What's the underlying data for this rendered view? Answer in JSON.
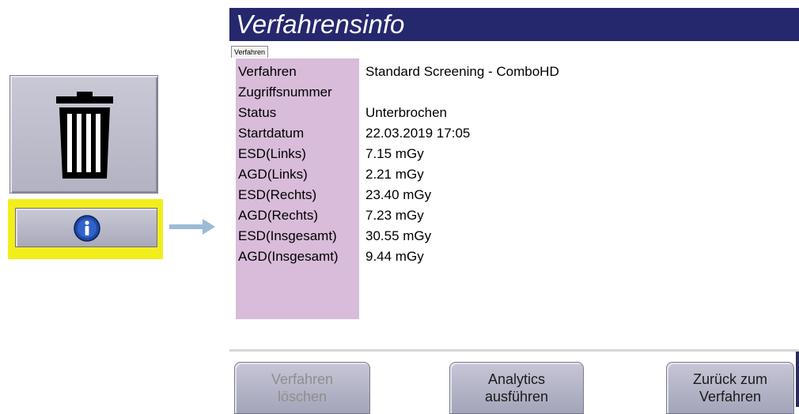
{
  "left_toolbar": {
    "trash_icon": "trash-icon",
    "info_icon": "info-icon",
    "highlight_color": "#f2ee1c",
    "arrow_color": "#9bbbd6"
  },
  "panel": {
    "title": "Verfahrensinfo",
    "title_bar_color": "#26286e",
    "tab_label": "Verfahren",
    "rows": [
      {
        "label": "Verfahren",
        "value": "Standard Screening - ComboHD"
      },
      {
        "label": "Zugriffsnummer",
        "value": ""
      },
      {
        "label": "Status",
        "value": "Unterbrochen"
      },
      {
        "label": "Startdatum",
        "value": "22.03.2019 17:05"
      },
      {
        "label": "ESD(Links)",
        "value": "7.15 mGy"
      },
      {
        "label": "AGD(Links)",
        "value": "2.21 mGy"
      },
      {
        "label": "ESD(Rechts)",
        "value": "23.40 mGy"
      },
      {
        "label": "AGD(Rechts)",
        "value": "7.23 mGy"
      },
      {
        "label": "ESD(Insgesamt)",
        "value": "30.55 mGy"
      },
      {
        "label": "AGD(Insgesamt)",
        "value": "9.44 mGy"
      }
    ],
    "label_column_color": "#d8bcda"
  },
  "footer": {
    "delete_label": "Verfahren\nlöschen",
    "analytics_label": "Analytics\nausführen",
    "back_label": "Zurück zum\nVerfahren"
  }
}
